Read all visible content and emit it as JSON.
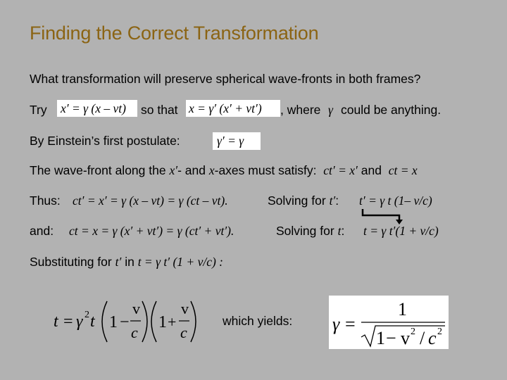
{
  "slide": {
    "title": "Finding the Correct Transformation",
    "title_color": "#8b6414",
    "background_color": "#b2b2b2",
    "question": "What transformation will preserve spherical wave-fronts in both frames?",
    "try_line": {
      "prefix": "Try",
      "eq1": "x′ = γ (x – vt)",
      "middle": "so that",
      "eq2": "x = γ′ (x′ + vt′)",
      "suffix_a": ", where",
      "gamma": "γ",
      "suffix_b": "could be anything."
    },
    "postulate_line": {
      "text": "By Einstein’s first postulate:",
      "eq": "γ′ = γ"
    },
    "wavefront_line": {
      "part1": "The wave-front along the",
      "x_prime": "x′",
      "part2": "- and",
      "x": "x",
      "part3": "-axes must satisfy:",
      "eq1": "ct′ = x′",
      "and": "and",
      "eq2": "ct = x"
    },
    "thus_line": {
      "label": "Thus:",
      "eq": "ct′ = x′ = γ (x – vt) =  γ (ct – vt).",
      "solving": "Solving for",
      "var": "t′",
      "colon": ":",
      "result": "t′ =  γ t (1– v/c)"
    },
    "and_line": {
      "label": "and:",
      "eq": "ct  = x  = γ (x′ + vt′) =  γ (ct′ + vt′).",
      "solving": "Solving for",
      "var": "t",
      "colon": ":",
      "result": "t =  γ t′(1 + v/c)"
    },
    "substituting_line": {
      "text": "Substituting for",
      "var": "t′",
      "in": "in",
      "eq": "t =  γ t′ (1 + v/c) :"
    },
    "product_equation": {
      "lhs": "t = γ²t",
      "factor1": "1 − v/c",
      "factor2": "1 + v/c",
      "one": "1",
      "minus": "−",
      "plus": "+",
      "v": "v",
      "c": "c",
      "t": "t",
      "eq": "=",
      "gamma": "γ",
      "sq": "2"
    },
    "yields_label": "which yields:",
    "gamma_formula": {
      "lhs": "γ =",
      "numerator": "1",
      "denominator": "1 − v² / c²",
      "den_one": "1",
      "den_minus": "−",
      "den_v": "v",
      "den_sq": "2",
      "den_slash": "/",
      "den_c": "c"
    },
    "arrow_connector": "t′ → t′"
  }
}
